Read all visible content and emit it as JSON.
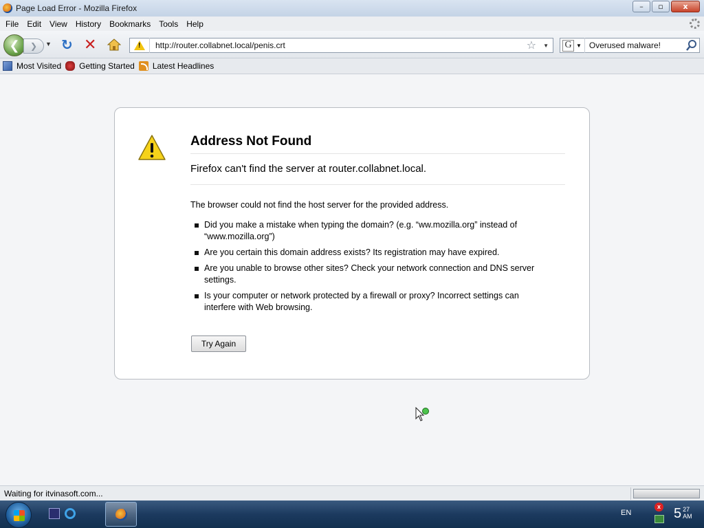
{
  "window": {
    "title": "Page Load Error - Mozilla Firefox",
    "minimize": "–",
    "maximize": "▫",
    "close": "x"
  },
  "menu": [
    {
      "label": "File"
    },
    {
      "label": "Edit"
    },
    {
      "label": "View"
    },
    {
      "label": "History"
    },
    {
      "label": "Bookmarks"
    },
    {
      "label": "Tools"
    },
    {
      "label": "Help"
    }
  ],
  "nav": {
    "url": "http://router.collabnet.local/penis.crt",
    "search_value": "Overused malware!",
    "search_engine": "G"
  },
  "bookmarks": [
    {
      "label": "Most Visited",
      "icon": "most-visited-icon"
    },
    {
      "label": "Getting Started",
      "icon": "getting-started-icon"
    },
    {
      "label": "Latest Headlines",
      "icon": "rss-icon"
    }
  ],
  "error": {
    "title": "Address Not Found",
    "description": "Firefox can't find the server at router.collabnet.local.",
    "intro": "The browser could not find the host server for the provided address.",
    "bullets": [
      "Did you make a mistake when typing the domain? (e.g. “ww.mozilla.org” instead of “www.mozilla.org”)",
      "Are you certain this domain address exists? Its registration may have expired.",
      "Are you unable to browse other sites? Check your network connection and DNS server settings.",
      "Is your computer or network protected by a firewall or proxy? Incorrect settings can interfere with Web browsing."
    ],
    "button": "Try Again"
  },
  "status": {
    "text": "Waiting for itvinasoft.com...",
    "progress": 1.0
  },
  "taskbar": {
    "language": "EN",
    "clock_hour": "5",
    "clock_minute": "27",
    "clock_ampm": "AM"
  },
  "colors": {
    "link_blue": "#2b6fc4",
    "stop_red": "#c81e1e",
    "warning_yellow": "#f2c40f",
    "taskbar_blue": "#1c3a5f"
  }
}
